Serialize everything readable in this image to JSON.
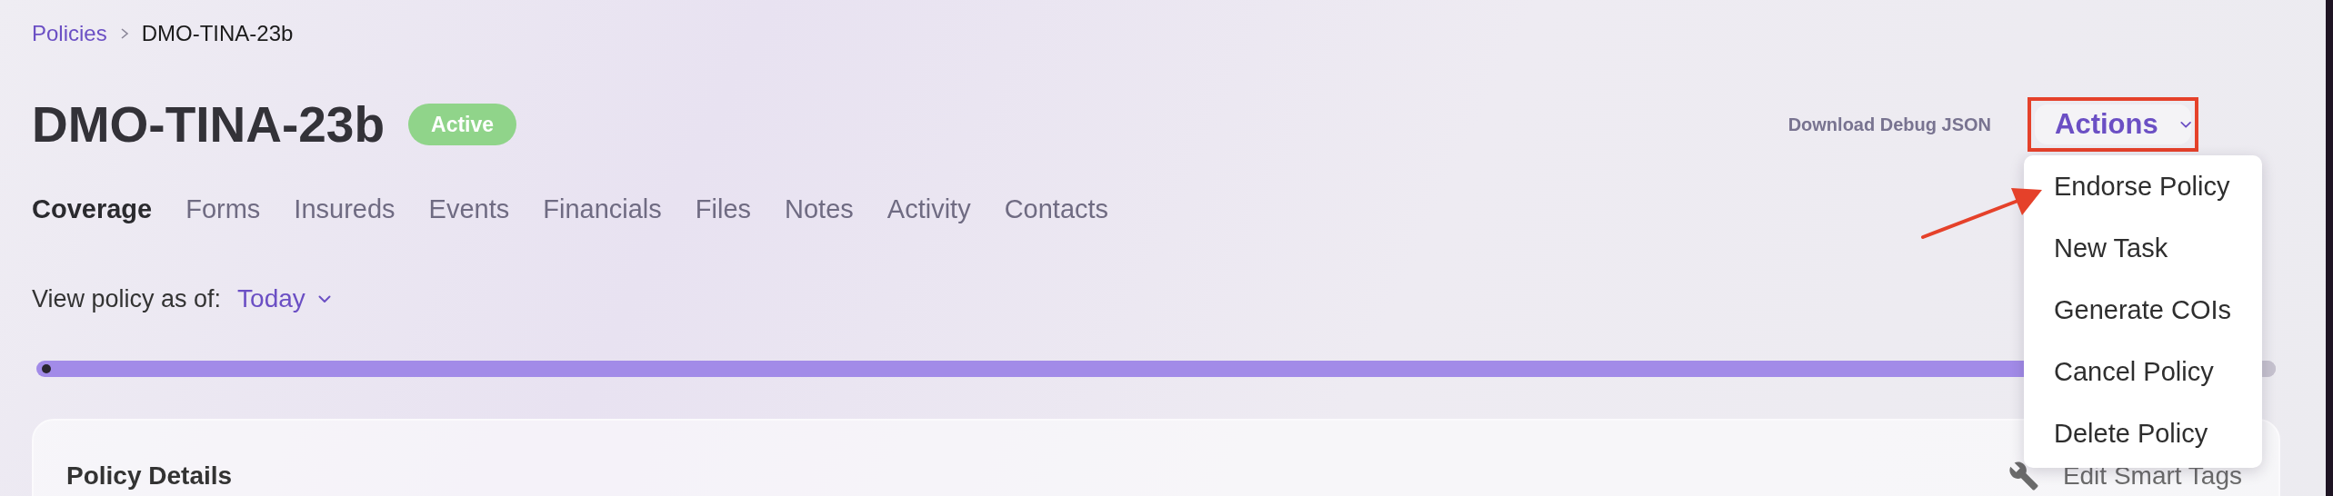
{
  "breadcrumb": [
    {
      "label": "Policies",
      "kind": "link"
    },
    {
      "label": "DMO-TINA-23b",
      "kind": "current"
    }
  ],
  "title": "DMO-TINA-23b",
  "status_badge": "Active",
  "download_link": "Download Debug JSON",
  "actions_button": "Actions",
  "actions_menu": {
    "expanded": true,
    "items": [
      "Endorse Policy",
      "New Task",
      "Generate COIs",
      "Cancel Policy",
      "Delete Policy"
    ]
  },
  "tabs": [
    {
      "label": "Coverage",
      "selected": true
    },
    {
      "label": "Forms",
      "selected": false
    },
    {
      "label": "Insureds",
      "selected": false
    },
    {
      "label": "Events",
      "selected": false
    },
    {
      "label": "Financials",
      "selected": false
    },
    {
      "label": "Files",
      "selected": false
    },
    {
      "label": "Notes",
      "selected": false
    },
    {
      "label": "Activity",
      "selected": false
    },
    {
      "label": "Contacts",
      "selected": false
    }
  ],
  "view_as": {
    "label": "View policy as of:",
    "value": "Today"
  },
  "card": {
    "title": "Policy Details",
    "edit_link": "Edit Smart Tags"
  }
}
